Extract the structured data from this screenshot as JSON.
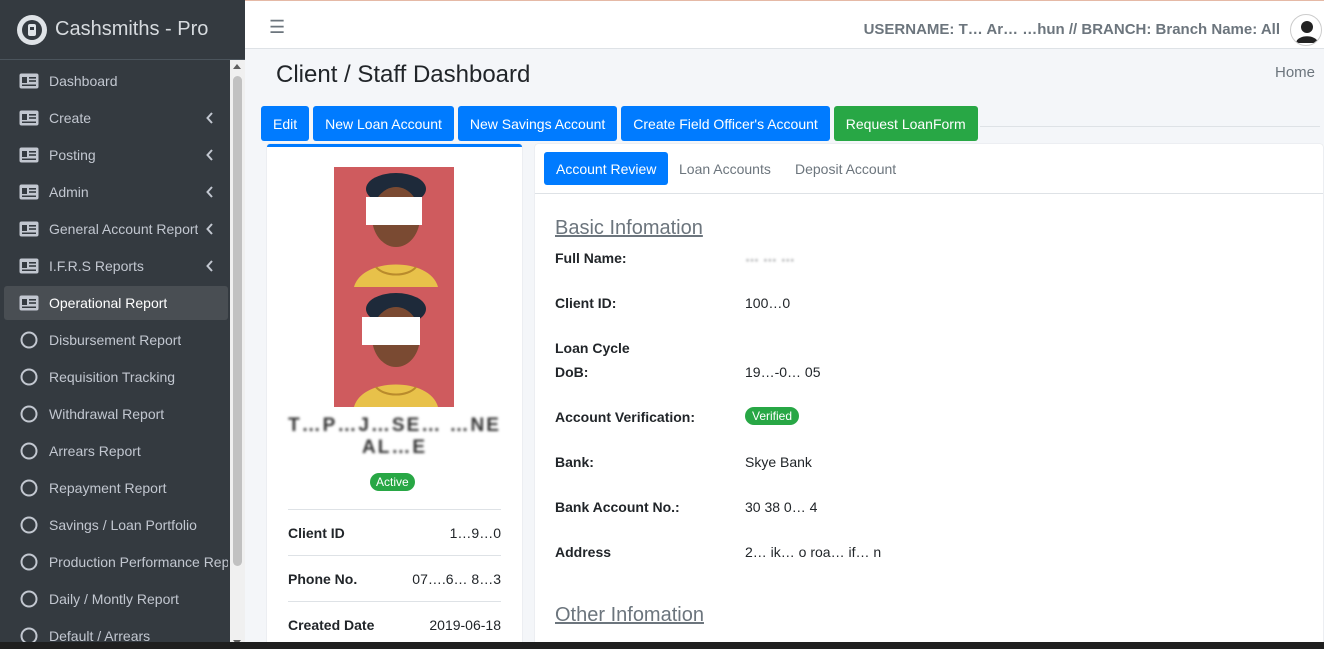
{
  "app": {
    "brand": "Cashsmiths - Pro"
  },
  "header": {
    "user_info": "USERNAME: T… Ar… …hun // BRANCH: Branch Name: All"
  },
  "sidebar": {
    "items": [
      {
        "label": "Dashboard",
        "icon": "id-card-icon",
        "caret": false,
        "active": false
      },
      {
        "label": "Create",
        "icon": "id-card-icon",
        "caret": true,
        "active": false
      },
      {
        "label": "Posting",
        "icon": "id-card-icon",
        "caret": true,
        "active": false
      },
      {
        "label": "Admin",
        "icon": "id-card-icon",
        "caret": true,
        "active": false
      },
      {
        "label": "General Account Report",
        "icon": "id-card-icon",
        "caret": true,
        "active": false
      },
      {
        "label": "I.F.R.S Reports",
        "icon": "id-card-icon",
        "caret": true,
        "active": false
      },
      {
        "label": "Operational Report",
        "icon": "id-card-icon",
        "caret": false,
        "active": true
      },
      {
        "label": "Disbursement Report",
        "icon": "circle-icon",
        "caret": false,
        "active": false
      },
      {
        "label": "Requisition Tracking",
        "icon": "circle-icon",
        "caret": false,
        "active": false
      },
      {
        "label": "Withdrawal Report",
        "icon": "circle-icon",
        "caret": false,
        "active": false
      },
      {
        "label": "Arrears Report",
        "icon": "circle-icon",
        "caret": false,
        "active": false
      },
      {
        "label": "Repayment Report",
        "icon": "circle-icon",
        "caret": false,
        "active": false
      },
      {
        "label": "Savings / Loan Portfolio",
        "icon": "circle-icon",
        "caret": false,
        "active": false
      },
      {
        "label": "Production Performance Rep",
        "icon": "circle-icon",
        "caret": false,
        "active": false
      },
      {
        "label": "Daily / Montly Report",
        "icon": "circle-icon",
        "caret": false,
        "active": false
      },
      {
        "label": "Default / Arrears",
        "icon": "circle-icon",
        "caret": false,
        "active": false
      }
    ]
  },
  "page": {
    "title": "Client / Staff Dashboard",
    "breadcrumb": "Home"
  },
  "actions": {
    "edit": "Edit",
    "new_loan": "New Loan Account",
    "new_savings": "New Savings Account",
    "field_officer": "Create Field Officer's Account",
    "request_loan": "Request LoanForm"
  },
  "profile": {
    "name_line1": "T…P…J…SE… …NE",
    "name_line2": "AL…E",
    "status": "Active",
    "rows": [
      {
        "key": "Client ID",
        "value": "1…9…0"
      },
      {
        "key": "Phone No.",
        "value": "07….6… 8…3"
      },
      {
        "key": "Created Date",
        "value": "2019-06-18"
      }
    ]
  },
  "tabs": {
    "review": "Account Review",
    "loan": "Loan Accounts",
    "deposit": "Deposit Account"
  },
  "basic": {
    "title": "Basic Infomation",
    "full_name_label": "Full Name:",
    "full_name_value": "… … …",
    "client_id_label": "Client ID:",
    "client_id_value": "100…0",
    "loan_cycle_label": "Loan Cycle",
    "dob_label": "DoB:",
    "dob_value": "19…-0… 05",
    "verification_label": "Account Verification:",
    "verification_value": "Verified",
    "bank_label": "Bank:",
    "bank_value": "Skye Bank",
    "bank_acct_label": "Bank Account No.:",
    "bank_acct_value": "30 38 0… 4",
    "address_label": "Address",
    "address_value": "2… ik… o roa… if… n"
  },
  "other": {
    "title": "Other Infomation"
  }
}
